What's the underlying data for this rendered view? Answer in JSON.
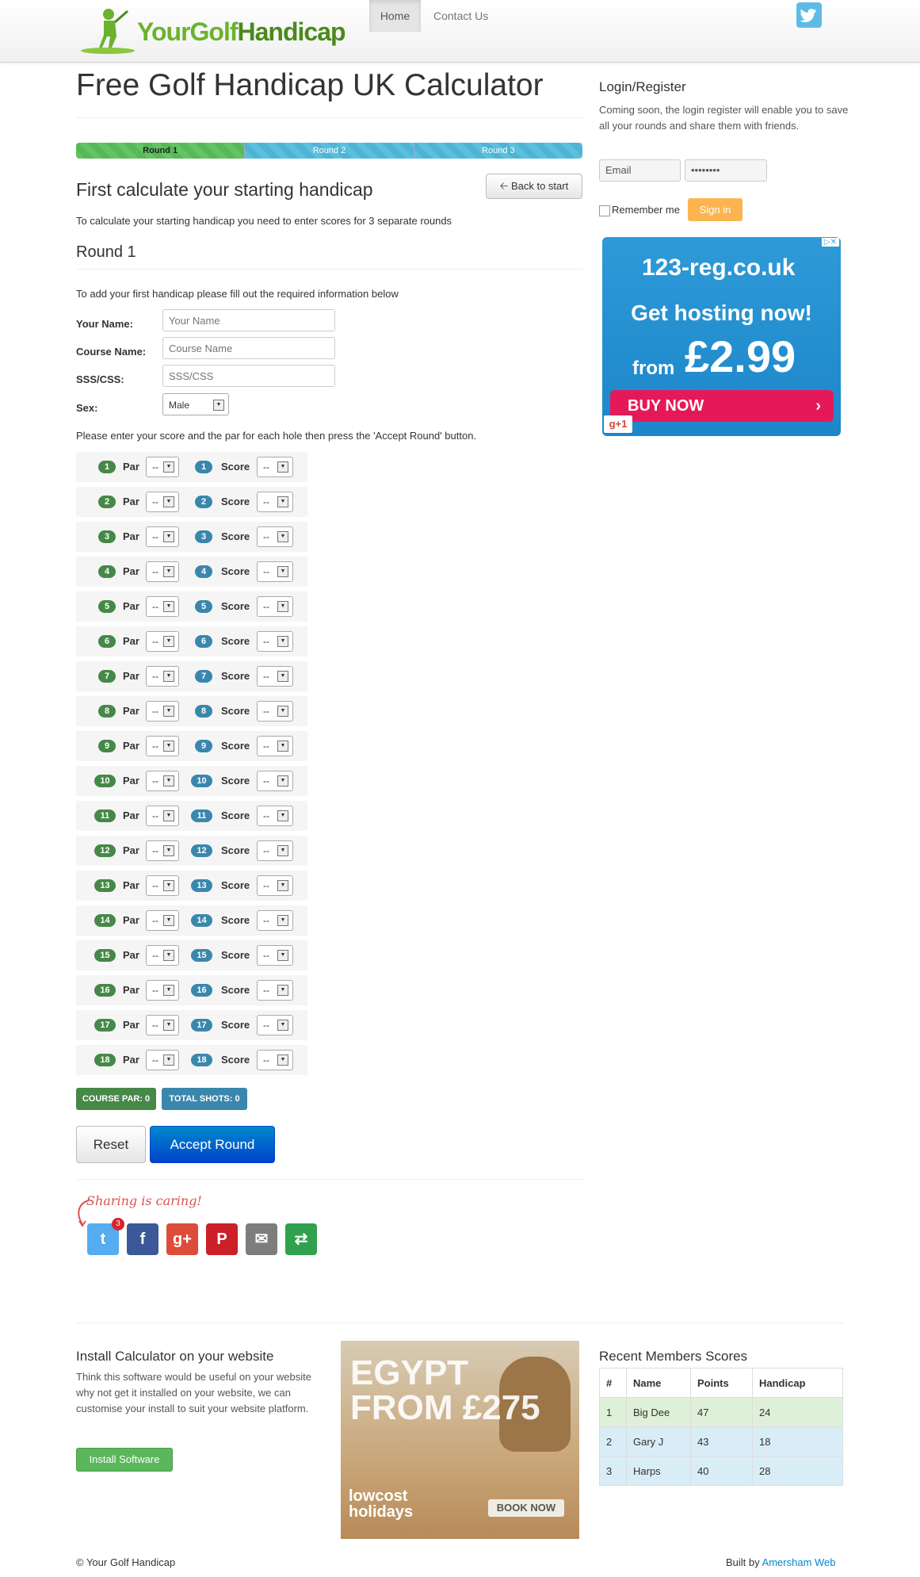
{
  "header": {
    "logo_text_1": "YourGolf",
    "logo_text_2": "Handicap",
    "nav_home": "Home",
    "nav_contact": "Contact Us",
    "twitter_icon": "twitter-icon"
  },
  "main": {
    "title": "Free Golf Handicap UK Calculator",
    "progress": [
      "Round 1",
      "Round 2",
      "Round 3"
    ],
    "back_button": "Back to start",
    "subtitle": "First calculate your starting handicap",
    "intro": "To calculate your starting handicap you need to enter scores for 3 separate rounds",
    "round_title": "Round 1",
    "round_intro": "To add your first handicap please fill out the required information below",
    "form": {
      "name_label": "Your Name:",
      "name_placeholder": "Your Name",
      "course_label": "Course Name:",
      "course_placeholder": "Course Name",
      "sss_label": "SSS/CSS:",
      "sss_placeholder": "SSS/CSS",
      "sex_label": "Sex:",
      "sex_value": "Male"
    },
    "holes_intro": "Please enter your score and the par for each hole then press the 'Accept Round' button.",
    "par_label": "Par",
    "score_label": "Score",
    "select_default": "--",
    "holes": [
      "1",
      "2",
      "3",
      "4",
      "5",
      "6",
      "7",
      "8",
      "9",
      "10",
      "11",
      "12",
      "13",
      "14",
      "15",
      "16",
      "17",
      "18"
    ],
    "course_par": "COURSE PAR: 0",
    "total_shots": "TOTAL SHOTS: 0",
    "reset_button": "Reset",
    "accept_button": "Accept Round",
    "sharing_text": "Sharing is caring!",
    "share_icons": [
      {
        "name": "twitter-icon",
        "glyph": "t",
        "color": "#55acee"
      },
      {
        "name": "facebook-icon",
        "glyph": "f",
        "color": "#3b5998"
      },
      {
        "name": "google-plus-icon",
        "glyph": "g+",
        "color": "#dd4b39"
      },
      {
        "name": "pinterest-icon",
        "glyph": "P",
        "color": "#cb2027"
      },
      {
        "name": "email-icon",
        "glyph": "✉",
        "color": "#7d7d7d"
      },
      {
        "name": "share-more-icon",
        "glyph": "⇄",
        "color": "#30a14e"
      }
    ],
    "twitter_count": "3"
  },
  "sidebar": {
    "login_title": "Login/Register",
    "login_text": "Coming soon, the login register will enable you to save all your rounds and share them with friends.",
    "email_placeholder": "Email",
    "password_value": "••••••••",
    "remember_label": "Remember me",
    "signin_button": "Sign in",
    "ad": {
      "logo": "123-reg.co.uk",
      "headline": "Get hosting now!",
      "from": "from",
      "price": "£2.99",
      "cta": "BUY NOW",
      "gplus": "g+1"
    }
  },
  "footer_section": {
    "install_title": "Install Calculator on your website",
    "install_text": "Think this software would be useful on your website why not get it installed on your website, we can customise your install to suit your website platform.",
    "install_button": "Install Software",
    "ad2": {
      "line1": "EGYPT",
      "line2": "FROM £275",
      "brand": "lowcost holidays",
      "cta": "BOOK NOW"
    },
    "recent_title": "Recent Members Scores",
    "table_headers": [
      "#",
      "Name",
      "Points",
      "Handicap"
    ],
    "table_rows": [
      [
        "1",
        "Big Dee",
        "47",
        "24"
      ],
      [
        "2",
        "Gary J",
        "43",
        "18"
      ],
      [
        "3",
        "Harps",
        "40",
        "28"
      ]
    ]
  },
  "footer": {
    "copyright": "© Your Golf Handicap",
    "built_by": "Built by",
    "built_link": "Amersham Web"
  }
}
